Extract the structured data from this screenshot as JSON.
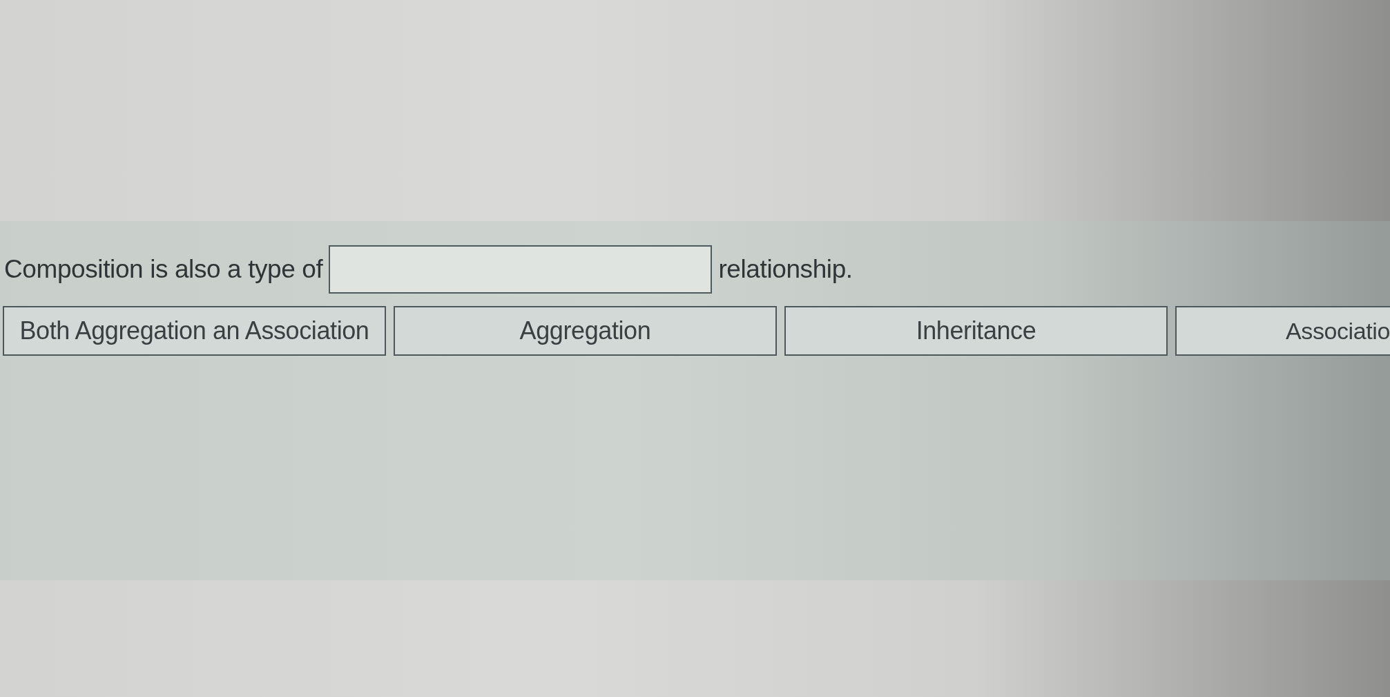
{
  "question": {
    "parts": [
      {
        "kind": "text",
        "text": "Composition is also a type of"
      },
      {
        "kind": "blank"
      },
      {
        "kind": "text",
        "text": "relationship."
      }
    ]
  },
  "options": [
    {
      "label": "Both Aggregation an Association"
    },
    {
      "label": "Aggregation"
    },
    {
      "label": "Inheritance"
    },
    {
      "label": "Associatio"
    }
  ]
}
